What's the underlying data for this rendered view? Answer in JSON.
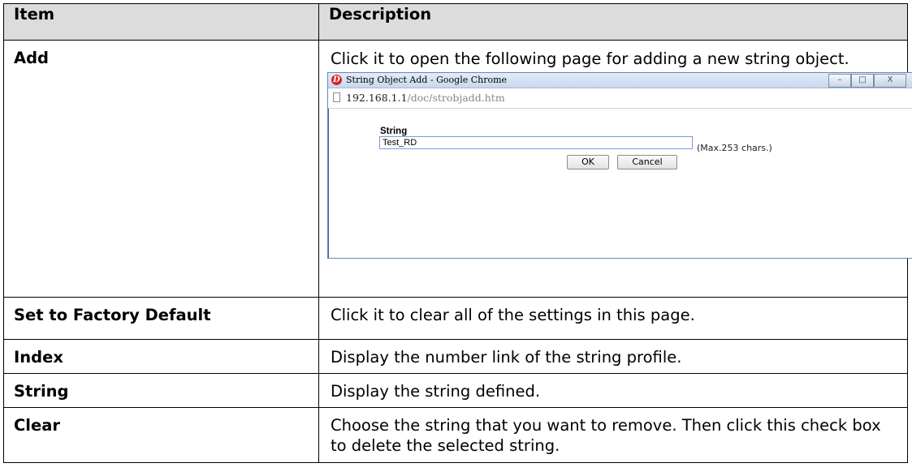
{
  "table": {
    "headers": {
      "item": "Item",
      "description": "Description"
    },
    "rows": [
      {
        "item": "Add",
        "description": "Click it to open the following page for adding a new string object."
      },
      {
        "item": "Set to Factory Default",
        "description": "Click it to clear all of the settings in this page."
      },
      {
        "item": "Index",
        "description": "Display the number link of the string profile."
      },
      {
        "item": "String",
        "description": "Display the string defined."
      },
      {
        "item": "Clear",
        "description": "Choose the string that you want to remove. Then click this check box to delete the selected string."
      }
    ]
  },
  "popup": {
    "window_title": "String Object Add - Google Chrome",
    "app_icon_glyph": "D",
    "window_buttons": {
      "minimize": "–",
      "maximize": "□",
      "close": "X"
    },
    "url_host": "192.168.1.1",
    "url_path": "/doc/strobjadd.htm",
    "field_label": "String",
    "field_value": "Test_RD",
    "field_hint": "(Max.253 chars.)",
    "ok_label": "OK",
    "cancel_label": "Cancel"
  }
}
